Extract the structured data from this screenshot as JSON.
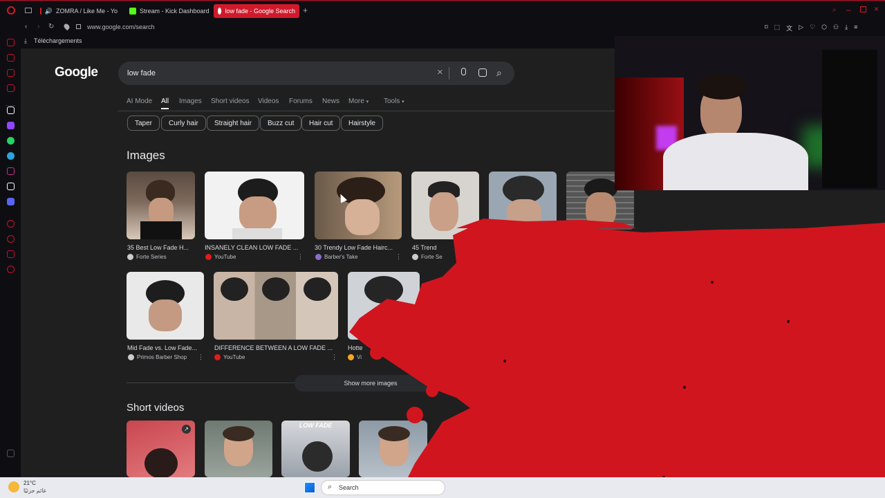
{
  "browser": {
    "tabs": [
      {
        "label": "ZOMRA / Like Me - Yo",
        "icon": "youtube-icon"
      },
      {
        "label": "Stream - Kick Dashboard",
        "icon": "kick-icon"
      },
      {
        "label": "low fade - Google Search",
        "icon": "google-icon"
      }
    ],
    "url": "www.google.com/search",
    "downloads_label": "Téléchargements"
  },
  "google": {
    "logo": "Google",
    "query": "low fade",
    "tabs": [
      "AI Mode",
      "All",
      "Images",
      "Short videos",
      "Videos",
      "Forums",
      "News",
      "More",
      "Tools"
    ],
    "active_tab": "All",
    "chips": [
      "Taper",
      "Curly hair",
      "Straight hair",
      "Buzz cut",
      "Hair cut",
      "Hairstyle"
    ],
    "images_heading": "Images",
    "image_results": [
      {
        "caption": "35 Best Low Fade H...",
        "source": "Forte Series"
      },
      {
        "caption": "INSANELY CLEAN LOW FADE ...",
        "source": "YouTube"
      },
      {
        "caption": "30 Trendy Low Fade Hairc...",
        "source": "Barber's Take"
      },
      {
        "caption": "45 Trend",
        "source": "Forte Se"
      },
      {
        "caption": "Mid Fade vs. Low Fade...",
        "source": "Primos Barber Shop"
      },
      {
        "caption": "DIFFERENCE BETWEEN A LOW FADE ...",
        "source": "YouTube"
      },
      {
        "caption": "Hotte",
        "source": "Vi"
      }
    ],
    "show_more": "Show more images",
    "short_videos_heading": "Short videos",
    "video_overlay": "LOW FADE"
  },
  "taskbar": {
    "temperature": "21°C",
    "weather": "غائم جزئيًا",
    "search_placeholder": "Search"
  },
  "colors": {
    "accent": "#d01a2c",
    "background": "#1f1f1f",
    "browser_chrome": "#0e0e12"
  }
}
